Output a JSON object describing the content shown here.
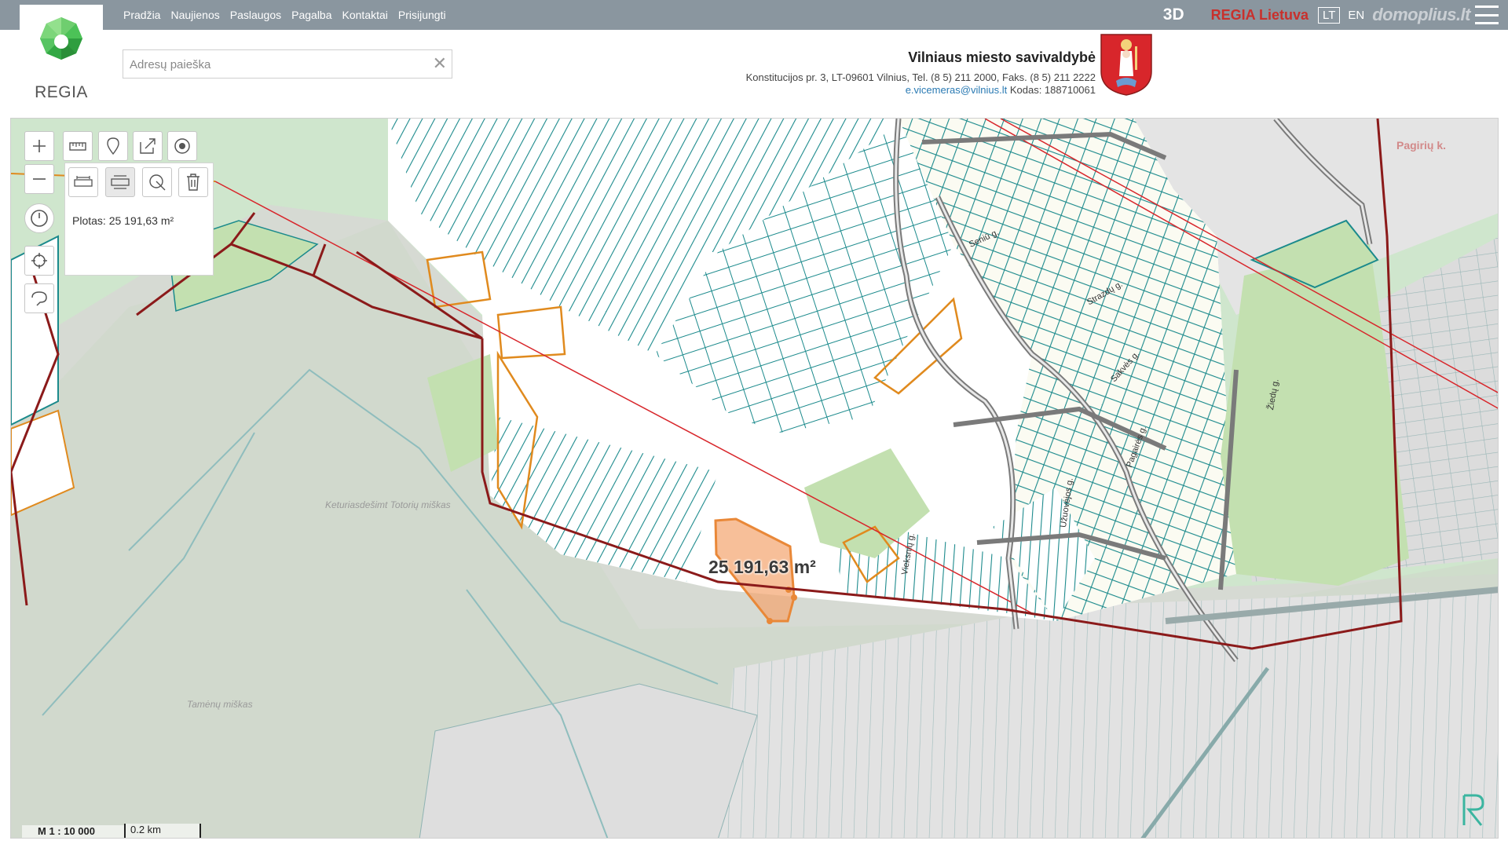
{
  "nav": {
    "items": [
      "Pradžia",
      "Naujienos",
      "Paslaugos",
      "Pagalba",
      "Kontaktai",
      "Prisijungti"
    ]
  },
  "top_right": {
    "mode_3d": "3D",
    "brand": "REGIA Lietuva",
    "languages": [
      "LT",
      "EN"
    ],
    "active_language": "LT",
    "watermark": "domoplius.lt"
  },
  "logo": {
    "text": "REGIA"
  },
  "search": {
    "placeholder": "Adresų paieška",
    "value": ""
  },
  "municipality": {
    "title": "Vilniaus miesto savivaldybė",
    "address": "Konstitucijos pr. 3, LT-09601 Vilnius, Tel. (8 5) 211 2000, Faks. (8 5) 211 2222",
    "email": "e.vicemeras@vilnius.lt",
    "code": "Kodas: 188710061"
  },
  "map": {
    "measure_result": "Plotas: 25 191,63 m²",
    "area_label": "25 191,63 m²",
    "place_names": [
      "Keturiasdešimt Totorių miškas",
      "Tamėnų miškas",
      "Pagirių k."
    ],
    "street_names": [
      "Seniū g.",
      "Strazdų g.",
      "Sakvės g.",
      "Pagairės g.",
      "Vieksnių g.",
      "Užuovėjos g.",
      "Žiedų g."
    ],
    "scale_ratio": "M 1 : 10 000",
    "scale_distance": "0.2 km"
  },
  "colors": {
    "topbar": "#8a969f",
    "parcel": "#1b8a8c",
    "boundary": "#8b1a1a",
    "orange": "#e08a1e",
    "highlight": "#f4a46e",
    "forest": "#cfe6cd",
    "grey_zone": "#dcdcdc"
  }
}
